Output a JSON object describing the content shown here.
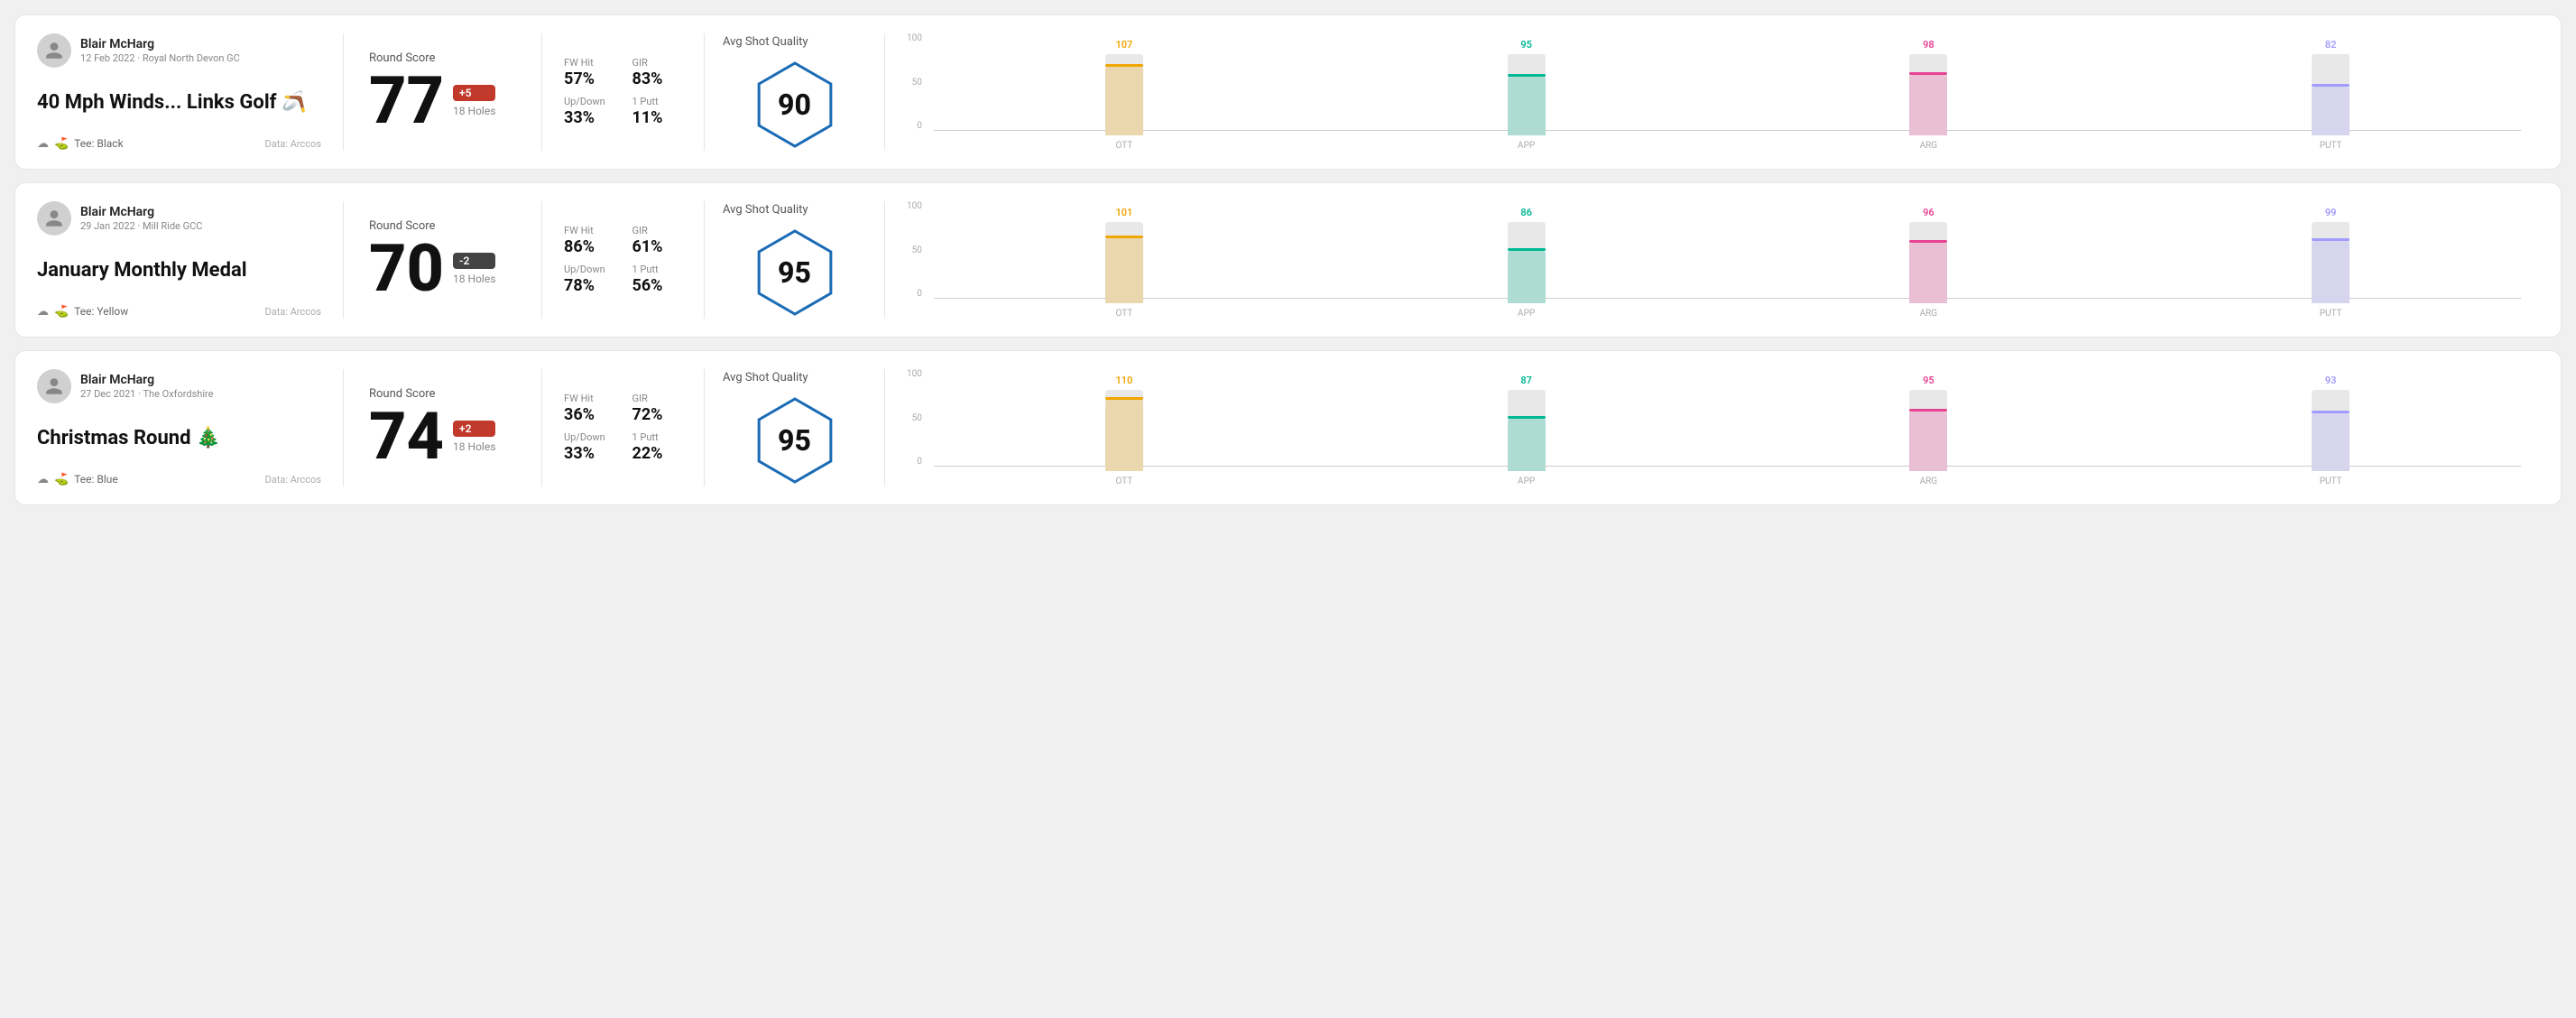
{
  "rounds": [
    {
      "id": "round-1",
      "user": {
        "name": "Blair McHarg",
        "date_course": "12 Feb 2022 · Royal North Devon GC"
      },
      "title": "40 Mph Winds... Links Golf 🪃",
      "tee": "Black",
      "data_source": "Data: Arccos",
      "score": 77,
      "score_diff": "+5",
      "score_diff_type": "positive",
      "holes": "18 Holes",
      "fw_hit": "57%",
      "gir": "83%",
      "up_down": "33%",
      "one_putt": "11%",
      "avg_shot_quality": 90,
      "chart": {
        "y_labels": [
          "100",
          "50",
          "0"
        ],
        "bars": [
          {
            "label": "OTT",
            "value": 107,
            "color": "#f0a500",
            "height_pct": 85
          },
          {
            "label": "APP",
            "value": 95,
            "color": "#00b894",
            "height_pct": 72
          },
          {
            "label": "ARG",
            "value": 98,
            "color": "#e84393",
            "height_pct": 75
          },
          {
            "label": "PUTT",
            "value": 82,
            "color": "#a29bfe",
            "height_pct": 60
          }
        ]
      }
    },
    {
      "id": "round-2",
      "user": {
        "name": "Blair McHarg",
        "date_course": "29 Jan 2022 · Mill Ride GCC"
      },
      "title": "January Monthly Medal",
      "tee": "Yellow",
      "data_source": "Data: Arccos",
      "score": 70,
      "score_diff": "-2",
      "score_diff_type": "negative",
      "holes": "18 Holes",
      "fw_hit": "86%",
      "gir": "61%",
      "up_down": "78%",
      "one_putt": "56%",
      "avg_shot_quality": 95,
      "chart": {
        "y_labels": [
          "100",
          "50",
          "0"
        ],
        "bars": [
          {
            "label": "OTT",
            "value": 101,
            "color": "#f0a500",
            "height_pct": 80
          },
          {
            "label": "APP",
            "value": 86,
            "color": "#00b894",
            "height_pct": 64
          },
          {
            "label": "ARG",
            "value": 96,
            "color": "#e84393",
            "height_pct": 74
          },
          {
            "label": "PUTT",
            "value": 99,
            "color": "#a29bfe",
            "height_pct": 77
          }
        ]
      }
    },
    {
      "id": "round-3",
      "user": {
        "name": "Blair McHarg",
        "date_course": "27 Dec 2021 · The Oxfordshire"
      },
      "title": "Christmas Round 🎄",
      "tee": "Blue",
      "data_source": "Data: Arccos",
      "score": 74,
      "score_diff": "+2",
      "score_diff_type": "positive",
      "holes": "18 Holes",
      "fw_hit": "36%",
      "gir": "72%",
      "up_down": "33%",
      "one_putt": "22%",
      "avg_shot_quality": 95,
      "chart": {
        "y_labels": [
          "100",
          "50",
          "0"
        ],
        "bars": [
          {
            "label": "OTT",
            "value": 110,
            "color": "#f0a500",
            "height_pct": 88
          },
          {
            "label": "APP",
            "value": 87,
            "color": "#00b894",
            "height_pct": 65
          },
          {
            "label": "ARG",
            "value": 95,
            "color": "#e84393",
            "height_pct": 73
          },
          {
            "label": "PUTT",
            "value": 93,
            "color": "#a29bfe",
            "height_pct": 71
          }
        ]
      }
    }
  ],
  "labels": {
    "round_score": "Round Score",
    "fw_hit": "FW Hit",
    "gir": "GIR",
    "up_down": "Up/Down",
    "one_putt": "1 Putt",
    "avg_shot_quality": "Avg Shot Quality",
    "tee_prefix": "Tee:"
  }
}
